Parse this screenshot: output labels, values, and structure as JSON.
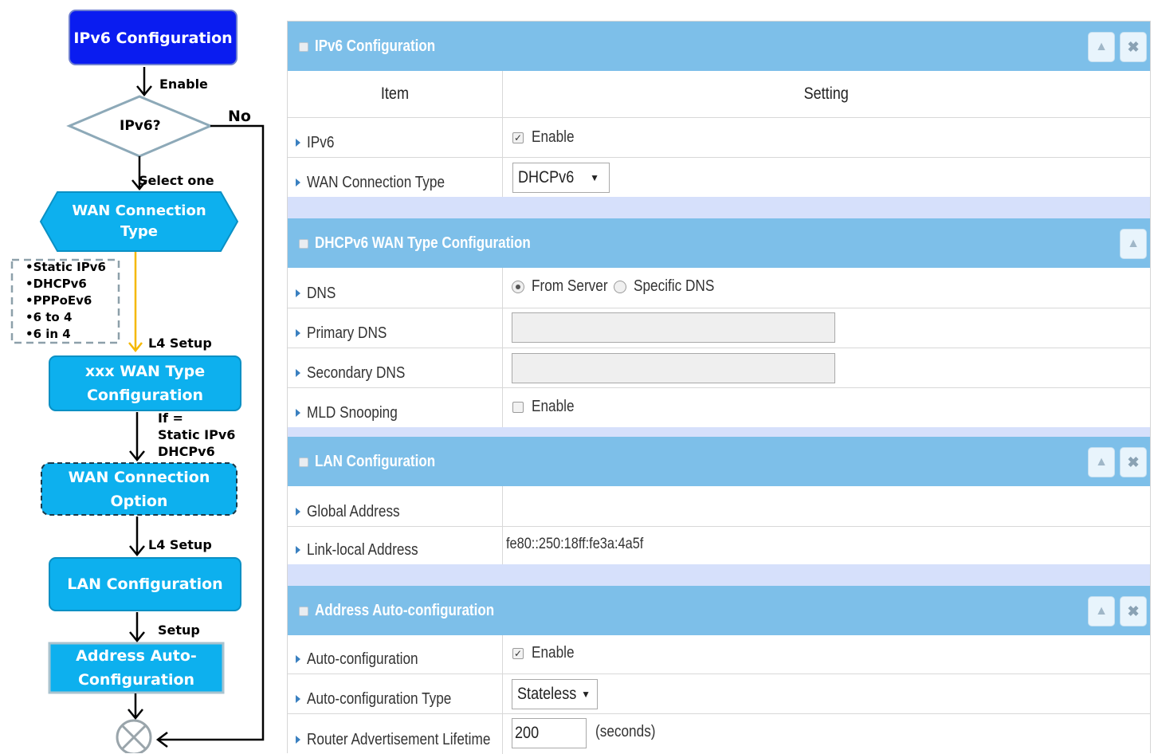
{
  "flowchart": {
    "start": "IPv6 Configuration",
    "enable_label": "Enable",
    "decision": "IPv6?",
    "no_label": "No",
    "select_label": "Select one",
    "wan_type": "WAN Connection Type",
    "types": [
      "•Static IPv6",
      "•DHCPv6",
      "•PPPoEv6",
      "•6 to 4",
      "•6 in 4"
    ],
    "l4_setup_1": "L4 Setup",
    "xxx_wan": "xxx WAN Type Configuration",
    "if_label": [
      "If =",
      "Static IPv6",
      "DHCPv6"
    ],
    "wan_option": "WAN Connection Option",
    "l4_setup_2": "L4 Setup",
    "lan": "LAN Configuration",
    "setup_label": "Setup",
    "auto_config": "Address Auto-Configuration",
    "colors": {
      "start_fill": "#0a1cf0",
      "box_fill": "#0db0ee",
      "accent_line": "#f5b800"
    }
  },
  "ipv6_config": {
    "title": "IPv6 Configuration",
    "header_item": "Item",
    "header_setting": "Setting",
    "ipv6_label": "IPv6",
    "ipv6_enable_text": "Enable",
    "ipv6_enabled": true,
    "wan_type_label": "WAN Connection Type",
    "wan_type_value": "DHCPv6"
  },
  "dhcpv6": {
    "title": "DHCPv6 WAN Type Configuration",
    "dns_label": "DNS",
    "dns_from_server": "From Server",
    "dns_specific": "Specific DNS",
    "dns_selected": "From Server",
    "primary_dns_label": "Primary DNS",
    "primary_dns_value": "",
    "secondary_dns_label": "Secondary DNS",
    "secondary_dns_value": "",
    "mld_label": "MLD Snooping",
    "mld_enable_text": "Enable",
    "mld_enabled": false
  },
  "lan_config": {
    "title": "LAN Configuration",
    "global_label": "Global Address",
    "global_value": "",
    "link_local_label": "Link-local Address",
    "link_local_value": "fe80::250:18ff:fe3a:4a5f"
  },
  "auto_config": {
    "title": "Address Auto-configuration",
    "auto_label": "Auto-configuration",
    "auto_enable_text": "Enable",
    "auto_enabled": true,
    "type_label": "Auto-configuration Type",
    "type_value": "Stateless",
    "lifetime_label": "Router Advertisement Lifetime",
    "lifetime_value": "200",
    "lifetime_unit": "(seconds)"
  },
  "icons": {
    "collapse": "collapse-up-icon",
    "close": "close-x-icon",
    "row_marker": "triangle-right-icon"
  },
  "colors": {
    "section_header": "#7dbfe9",
    "spacer": "#d6e0fb",
    "row_marker": "#3a80c0"
  }
}
